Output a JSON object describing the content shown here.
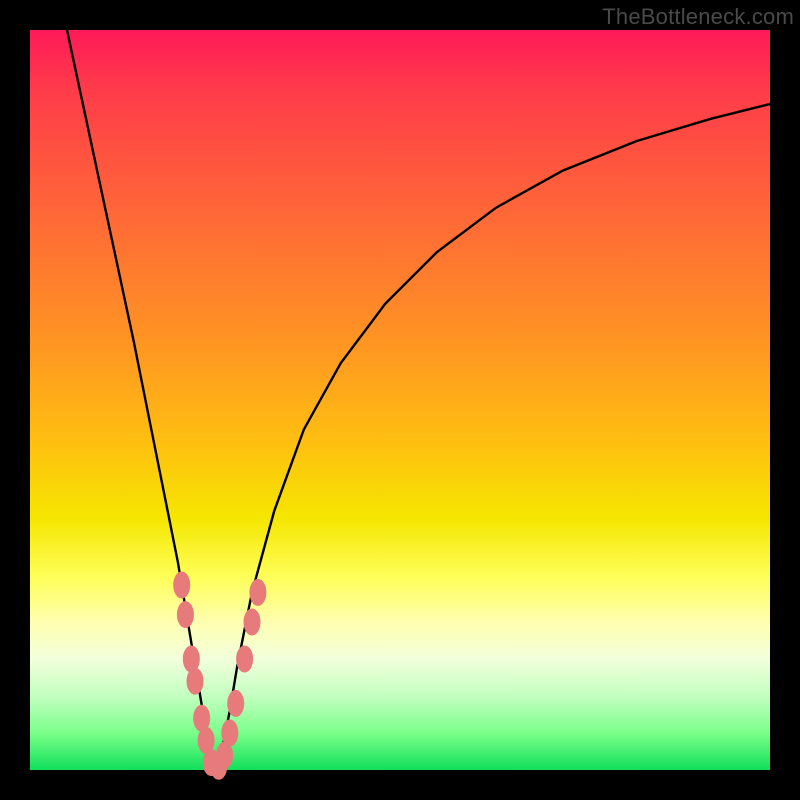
{
  "watermark": {
    "text": "TheBottleneck.com"
  },
  "colors": {
    "background": "#000000",
    "curve_stroke": "#000000",
    "marker_fill": "#e77b7b",
    "marker_stroke": "#e77b7b",
    "gradient_stops": [
      "#ff1a58",
      "#ff3b4a",
      "#ff5b3d",
      "#ff7a2f",
      "#ff9a20",
      "#ffc010",
      "#f5e600",
      "#ffff5a",
      "#ffffb0",
      "#f2ffdb",
      "#c3ffc0",
      "#7bff8a",
      "#10e05a"
    ]
  },
  "chart_data": {
    "type": "line",
    "title": "",
    "xlabel": "",
    "ylabel": "",
    "xlim": [
      0,
      100
    ],
    "ylim": [
      0,
      100
    ],
    "grid": false,
    "legend": "none",
    "series": [
      {
        "name": "left-branch",
        "x": [
          5,
          8,
          11,
          14,
          16,
          18,
          20,
          21,
          22,
          23,
          23.5,
          24,
          24.5,
          25
        ],
        "y": [
          100,
          86,
          72,
          58,
          48,
          38,
          28,
          22,
          16,
          10,
          7,
          4,
          2,
          0
        ]
      },
      {
        "name": "right-branch",
        "x": [
          25,
          26,
          27,
          28,
          30,
          33,
          37,
          42,
          48,
          55,
          63,
          72,
          82,
          92,
          100
        ],
        "y": [
          0,
          3,
          8,
          14,
          24,
          35,
          46,
          55,
          63,
          70,
          76,
          81,
          85,
          88,
          90
        ]
      }
    ],
    "markers": {
      "name": "highlighted-points",
      "note": "salmon lozenge markers near curve minimum",
      "points": [
        {
          "x": 20.5,
          "y": 25
        },
        {
          "x": 21.0,
          "y": 21
        },
        {
          "x": 21.8,
          "y": 15
        },
        {
          "x": 22.3,
          "y": 12
        },
        {
          "x": 23.2,
          "y": 7
        },
        {
          "x": 23.8,
          "y": 4
        },
        {
          "x": 24.5,
          "y": 1
        },
        {
          "x": 25.5,
          "y": 0.5
        },
        {
          "x": 26.3,
          "y": 2
        },
        {
          "x": 27.0,
          "y": 5
        },
        {
          "x": 27.8,
          "y": 9
        },
        {
          "x": 29.0,
          "y": 15
        },
        {
          "x": 30.0,
          "y": 20
        },
        {
          "x": 30.8,
          "y": 24
        }
      ]
    }
  }
}
